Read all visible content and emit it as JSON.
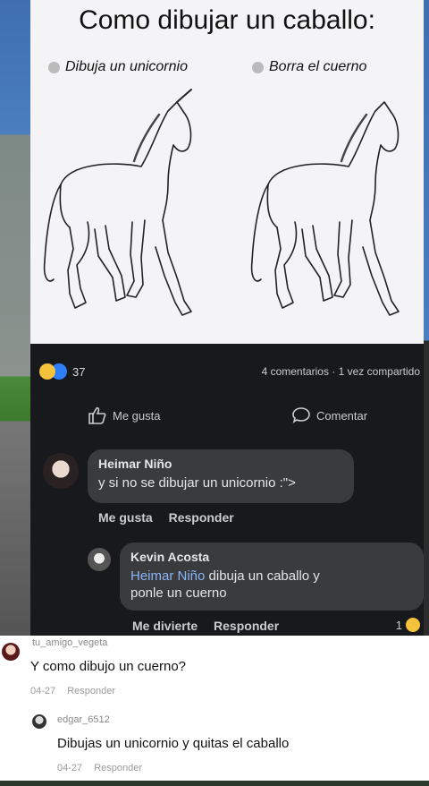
{
  "meme": {
    "title": "Como dibujar un caballo:",
    "step1": "Dibuja un unicornio",
    "step2": "Borra el cuerno"
  },
  "post": {
    "reaction_count": "37",
    "stats": "4 comentarios · 1 vez compartido",
    "like_label": "Me gusta",
    "comment_label": "Comentar"
  },
  "comments": [
    {
      "author": "Heimar Niño",
      "text": "y si no se dibujar un unicornio :\">",
      "like": "Me gusta",
      "reply": "Responder"
    },
    {
      "author": "Kevin Acosta",
      "mention": "Heimar Niño",
      "text_line1": " dibuja un caballo y",
      "text_line2": "ponle un cuerno",
      "react": "Me divierte",
      "reply": "Responder",
      "reaction_count": "1"
    }
  ],
  "replies": [
    {
      "username": "tu_amigo_vegeta",
      "text": "Y como dibujo un cuerno?",
      "date": "04-27",
      "reply": "Responder"
    },
    {
      "username": "edgar_6512",
      "text": "Dibujas un unicornio y quitas el caballo",
      "date": "04-27",
      "reply": "Responder"
    }
  ],
  "colors": {
    "fb_background": "#18191c",
    "bubble": "#3a3b3d",
    "mention": "#8ab4f8",
    "haha": "#f5c33b",
    "like": "#2d7ff9"
  }
}
